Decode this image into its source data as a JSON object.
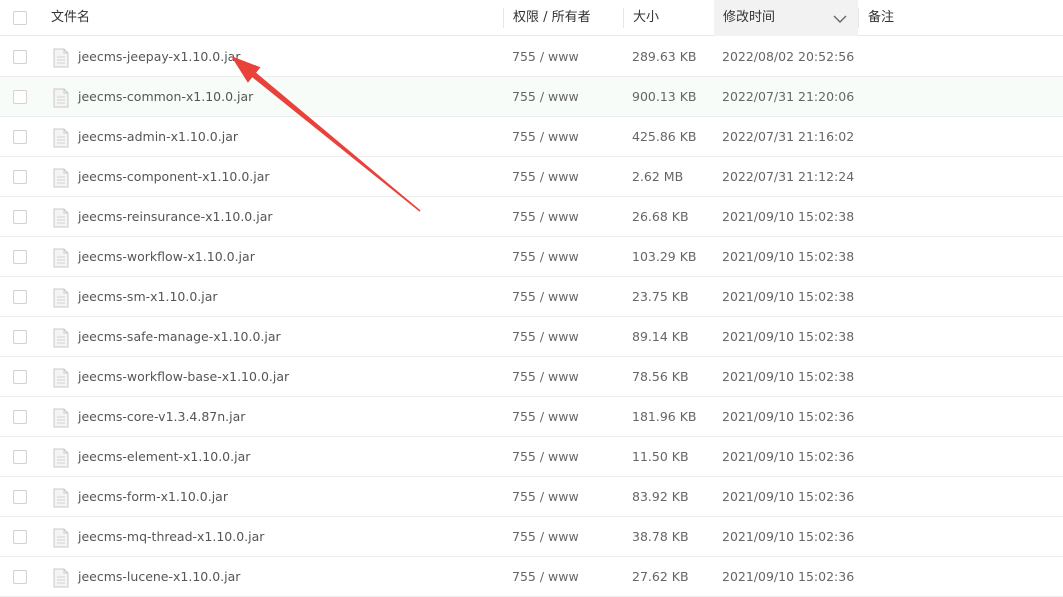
{
  "header": {
    "name": "文件名",
    "perm": "权限 / 所有者",
    "size": "大小",
    "mtime": "修改时间",
    "note": "备注",
    "sort_icon": "chevron-down-icon"
  },
  "colors": {
    "arrow": "#e8423b",
    "hover_row": "#f7fcf8",
    "border": "#ececec"
  },
  "files": [
    {
      "name": "jeecms-jeepay-x1.10.0.jar",
      "perm": "755 / www",
      "size": "289.63 KB",
      "mtime": "2022/08/02 20:52:56"
    },
    {
      "name": "jeecms-common-x1.10.0.jar",
      "perm": "755 / www",
      "size": "900.13 KB",
      "mtime": "2022/07/31 21:20:06"
    },
    {
      "name": "jeecms-admin-x1.10.0.jar",
      "perm": "755 / www",
      "size": "425.86 KB",
      "mtime": "2022/07/31 21:16:02"
    },
    {
      "name": "jeecms-component-x1.10.0.jar",
      "perm": "755 / www",
      "size": "2.62 MB",
      "mtime": "2022/07/31 21:12:24"
    },
    {
      "name": "jeecms-reinsurance-x1.10.0.jar",
      "perm": "755 / www",
      "size": "26.68 KB",
      "mtime": "2021/09/10 15:02:38"
    },
    {
      "name": "jeecms-workflow-x1.10.0.jar",
      "perm": "755 / www",
      "size": "103.29 KB",
      "mtime": "2021/09/10 15:02:38"
    },
    {
      "name": "jeecms-sm-x1.10.0.jar",
      "perm": "755 / www",
      "size": "23.75 KB",
      "mtime": "2021/09/10 15:02:38"
    },
    {
      "name": "jeecms-safe-manage-x1.10.0.jar",
      "perm": "755 / www",
      "size": "89.14 KB",
      "mtime": "2021/09/10 15:02:38"
    },
    {
      "name": "jeecms-workflow-base-x1.10.0.jar",
      "perm": "755 / www",
      "size": "78.56 KB",
      "mtime": "2021/09/10 15:02:38"
    },
    {
      "name": "jeecms-core-v1.3.4.87n.jar",
      "perm": "755 / www",
      "size": "181.96 KB",
      "mtime": "2021/09/10 15:02:36"
    },
    {
      "name": "jeecms-element-x1.10.0.jar",
      "perm": "755 / www",
      "size": "11.50 KB",
      "mtime": "2021/09/10 15:02:36"
    },
    {
      "name": "jeecms-form-x1.10.0.jar",
      "perm": "755 / www",
      "size": "83.92 KB",
      "mtime": "2021/09/10 15:02:36"
    },
    {
      "name": "jeecms-mq-thread-x1.10.0.jar",
      "perm": "755 / www",
      "size": "38.78 KB",
      "mtime": "2021/09/10 15:02:36"
    },
    {
      "name": "jeecms-lucene-x1.10.0.jar",
      "perm": "755 / www",
      "size": "27.62 KB",
      "mtime": "2021/09/10 15:02:36"
    }
  ]
}
